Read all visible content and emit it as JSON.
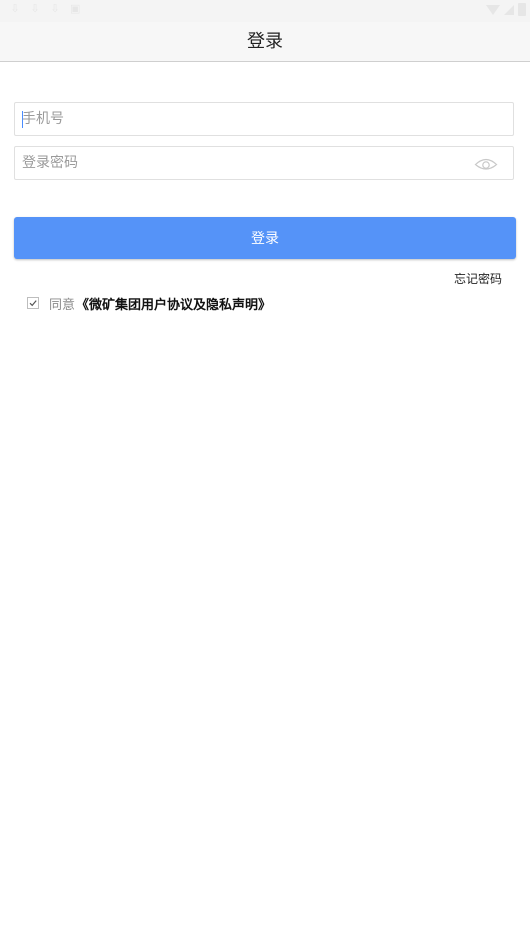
{
  "header": {
    "title": "登录"
  },
  "form": {
    "phone_placeholder": "手机号",
    "phone_value": "",
    "password_placeholder": "登录密码",
    "password_value": "",
    "login_label": "登录",
    "forgot_password_label": "忘记密码"
  },
  "agreement": {
    "checked": true,
    "prefix": "同意",
    "link_text": "《微矿集团用户协议及隐私声明》"
  },
  "theme": {
    "accent": "#5593f8",
    "header_bg": "#f7f7f7"
  },
  "icons": {
    "password_toggle": "eye-icon",
    "checkbox_mark": "check-icon"
  }
}
